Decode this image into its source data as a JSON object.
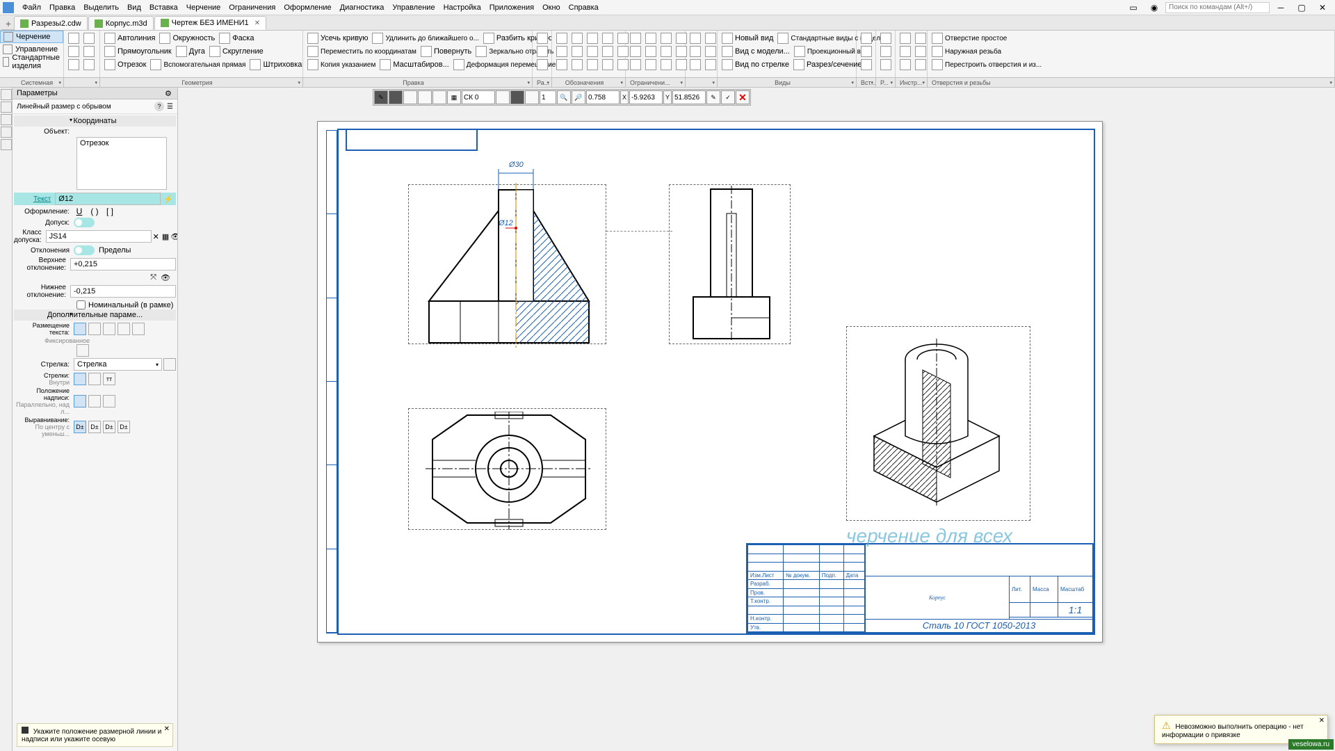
{
  "menu": {
    "items": [
      "Файл",
      "Правка",
      "Выделить",
      "Вид",
      "Вставка",
      "Черчение",
      "Ограничения",
      "Оформление",
      "Диагностика",
      "Управление",
      "Настройка",
      "Приложения",
      "Окно",
      "Справка"
    ],
    "search_placeholder": "Поиск по командам (Alt+/)"
  },
  "tabs": [
    {
      "label": "Разрезы2.cdw",
      "active": false
    },
    {
      "label": "Корпус.m3d",
      "active": false
    },
    {
      "label": "Чертеж БЕЗ ИМЕНИ1",
      "active": true
    }
  ],
  "ribbon": {
    "left_mode": "Черчение",
    "left_items": [
      "Управление",
      "Стандартные изделия"
    ],
    "groups": [
      {
        "name": "Системная",
        "items": [
          "",
          "",
          "",
          "",
          "",
          ""
        ]
      },
      {
        "name": "Геометрия",
        "items": [
          "Автолиния",
          "Окружность",
          "Фаска",
          "Прямоугольник",
          "Дуга",
          "Скругление",
          "Отрезок",
          "Вспомогатель­ная прямая",
          "Штриховка"
        ]
      },
      {
        "name": "Правка",
        "items": [
          "Усечь кривую",
          "Переместить по координатам",
          "Копия указанием",
          "Удлинить до ближайшего о...",
          "Повернуть",
          "Масштабиров...",
          "Разбить кривую",
          "Зеркально отразить",
          "Деформация перемещением"
        ]
      },
      {
        "name": "Ра...",
        "items": []
      },
      {
        "name": "Обозначения",
        "items": []
      },
      {
        "name": "Ограничени...",
        "items": []
      },
      {
        "name": "Виды",
        "items": [
          "Новый вид",
          "Вид с модели...",
          "Вид по стрелке",
          "Стандартные виды с модели...",
          "Проекционный вид",
          "Разрез/сечение"
        ]
      },
      {
        "name": "Вст...",
        "items": []
      },
      {
        "name": "Р...",
        "items": []
      },
      {
        "name": "Инстр...",
        "items": []
      },
      {
        "name": "Отверстия и резьбы",
        "items": [
          "Отверстие простое",
          "Наружная резьба",
          "Перестроить отверстия и из..."
        ]
      }
    ]
  },
  "canvas_toolbar": {
    "cs_label": "СК 0",
    "scale_one": "1",
    "zoom": "0.758",
    "x_label": "X",
    "x_val": "-5.9263",
    "y_label": "Y",
    "y_val": "51.8526"
  },
  "params": {
    "title": "Параметры",
    "subtitle": "Линейный размер с обрывом",
    "coords_header": "Координаты",
    "object_label": "Объект:",
    "object_value": "Отрезок",
    "text_label": "Текст",
    "text_value": "Ø12",
    "format_label": "Оформление:",
    "format_buttons": [
      "U",
      "( )",
      "[ ]"
    ],
    "tolerance_label": "Допуск:",
    "tol_class_label": "Класс допуска:",
    "tol_class_value": "JS14",
    "deviation_label": "Отклонения",
    "deviation_limits": "Пределы",
    "upper_label": "Верхнее отклонение:",
    "upper_value": "+0,215",
    "lower_label": "Нижнее отклонение:",
    "lower_value": "-0,215",
    "nominal_label": "Номинальный (в рамке)",
    "extra_header": "Дополнительные параме...",
    "text_place_label": "Размещение текста:",
    "text_place_sub": "Фиксированное",
    "arrow_label": "Стрелка:",
    "arrow_value": "Стрелка",
    "arrows_label": "Стрелки:",
    "arrows_sub": "Внутри",
    "caption_pos_label": "Положение надписи:",
    "caption_pos_sub": "Параллельно, над л...",
    "align_label": "Выравнивание:",
    "align_sub": "По центру с уменьш...",
    "align_buttons": [
      "D±",
      "D±",
      "D±",
      "D±"
    ],
    "hint": "Укажите положение размерной линии и надписи или укажите осевую"
  },
  "drawing": {
    "dim_d30": "Ø30",
    "dim_d12": "Ø12",
    "title_block": {
      "main": "Корпус",
      "material": "Сталь 10  ГОСТ 1050-2013",
      "headers": [
        "Изм.Лист",
        "№ докум.",
        "Подп.",
        "Дата",
        "Лит.",
        "Масса",
        "Масштаб"
      ],
      "rows": [
        "Разраб.",
        "Пров.",
        "Т.контр.",
        "Н.контр.",
        "Утв."
      ],
      "scale": "1:1"
    }
  },
  "notification": {
    "text": "Невозможно выполнить операцию - нет информации о привязке"
  },
  "watermark": "черчение для всех",
  "corner": "veselowa.ru"
}
